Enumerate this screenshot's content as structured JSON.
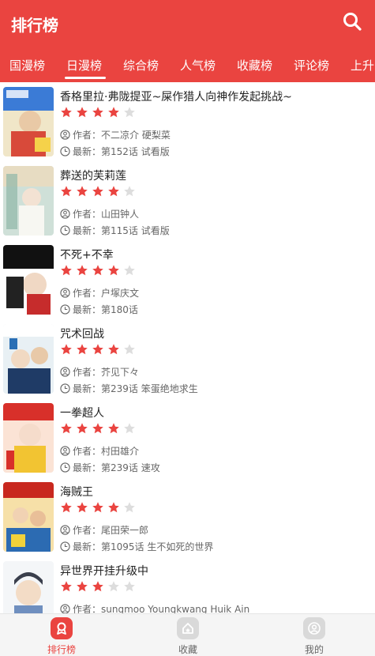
{
  "header": {
    "title": "排行榜",
    "bg_color": "#ea4440"
  },
  "tabs": [
    {
      "label": "国漫榜",
      "active": false
    },
    {
      "label": "日漫榜",
      "active": true
    },
    {
      "label": "综合榜",
      "active": false
    },
    {
      "label": "人气榜",
      "active": false
    },
    {
      "label": "收藏榜",
      "active": false
    },
    {
      "label": "评论榜",
      "active": false
    },
    {
      "label": "上升",
      "active": false
    }
  ],
  "list": {
    "author_prefix": "作者：",
    "latest_prefix": "最新：",
    "star_color": "#ea4440",
    "items": [
      {
        "title": "香格里拉·弗陇提亚~屎作猎人向神作发起挑战~",
        "rating": 4,
        "author": "不二凉介 硬梨菜",
        "latest": "第152话 试看版"
      },
      {
        "title": "葬送的芙莉莲",
        "rating": 4,
        "author": "山田钟人",
        "latest": "第115话 试看版"
      },
      {
        "title": "不死+不幸",
        "rating": 4,
        "author": "户塚庆文",
        "latest": "第180话"
      },
      {
        "title": "咒术回战",
        "rating": 4,
        "author": "芥见下々",
        "latest": "第239话 笨蛋绝地求生"
      },
      {
        "title": "一拳超人",
        "rating": 4,
        "author": "村田雄介",
        "latest": "第239话 速攻"
      },
      {
        "title": "海贼王",
        "rating": 4,
        "author": "尾田荣一郎",
        "latest": "第1095话 生不如死的世界"
      },
      {
        "title": "异世界开挂升级中",
        "rating": 3,
        "author": "sungmoo Youngkwang Huik Ain",
        "latest": ""
      }
    ]
  },
  "bottom_nav": [
    {
      "label": "排行榜",
      "icon": "ranking-icon",
      "active": true
    },
    {
      "label": "收藏",
      "icon": "favorites-icon",
      "active": false
    },
    {
      "label": "我的",
      "icon": "profile-icon",
      "active": false
    }
  ]
}
